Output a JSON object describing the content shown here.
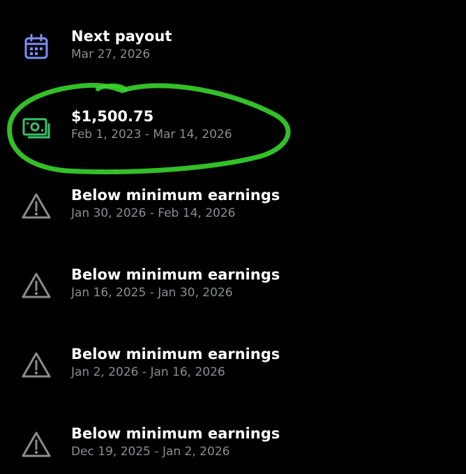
{
  "payouts": {
    "next": {
      "title": "Next payout",
      "date": "Mar 27, 2026",
      "icon": "calendar-icon",
      "icon_color": "#7b8ff5"
    },
    "current": {
      "amount": "$1,500.75",
      "range": "Feb 1, 2023 - Mar 14, 2026",
      "icon": "money-icon",
      "icon_color": "#37c46a"
    },
    "history": [
      {
        "title": "Below minimum earnings",
        "range": "Jan 30, 2026 - Feb 14, 2026",
        "icon": "warning-icon"
      },
      {
        "title": "Below minimum earnings",
        "range": "Jan 16, 2025 - Jan 30, 2026",
        "icon": "warning-icon"
      },
      {
        "title": "Below minimum earnings",
        "range": "Jan 2, 2026 - Jan 16, 2026",
        "icon": "warning-icon"
      },
      {
        "title": "Below minimum earnings",
        "range": "Dec 19, 2025 - Jan 2, 2026",
        "icon": "warning-icon"
      }
    ]
  },
  "colors": {
    "background": "#000000",
    "title": "#ffffff",
    "subtitle": "#8a8d92",
    "warning_icon": "#8a8d92",
    "highlight_scribble": "#39d42e"
  }
}
